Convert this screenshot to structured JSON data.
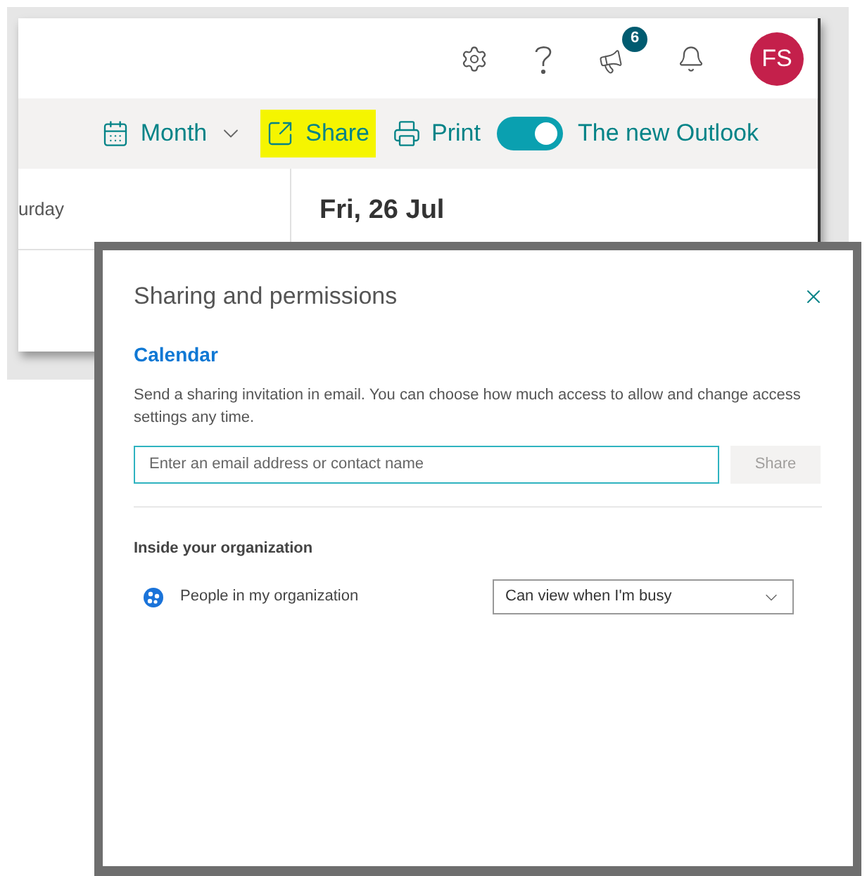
{
  "top_bar": {
    "notification_count": "6",
    "avatar_initials": "FS"
  },
  "toolbar": {
    "items": [
      {
        "kind": "dropdown",
        "label": "Month",
        "highlighted": false
      },
      {
        "kind": "share",
        "label": "Share",
        "highlighted": true
      },
      {
        "kind": "print",
        "label": "Print",
        "highlighted": false
      },
      {
        "kind": "toggle",
        "label": "The new Outlook",
        "on": true
      }
    ]
  },
  "calendar": {
    "day_header": "urday",
    "date_heading": "Fri, 26 Jul"
  },
  "dialog": {
    "title": "Sharing and permissions",
    "section": "Calendar",
    "description": "Send a sharing invitation in email. You can choose how much access to allow and change access settings any time.",
    "email_field": {
      "placeholder": "Enter an email address or contact name"
    },
    "share_button": {
      "label": "Share",
      "disabled": true
    },
    "group_heading": "Inside your organization",
    "permissions": [
      {
        "name": "People in my organization",
        "access": "Can view when I'm busy"
      }
    ]
  }
}
